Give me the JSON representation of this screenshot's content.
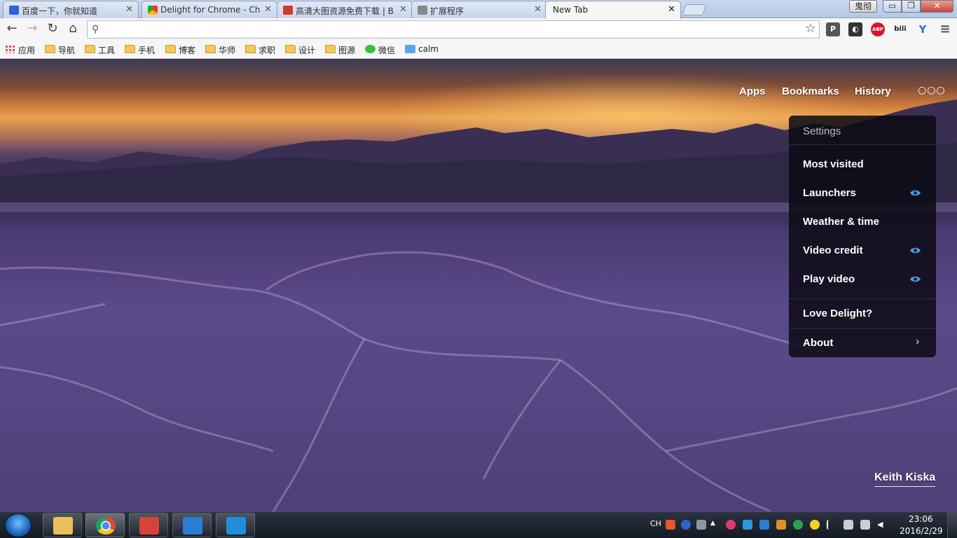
{
  "tabs": [
    {
      "title": "百度一下，你就知道",
      "favicon": "baidu-paw-icon",
      "color": "#3060d8"
    },
    {
      "title": "Delight for Chrome - Ch",
      "favicon": "chrome-webstore-icon",
      "color": "#e8a030"
    },
    {
      "title": "高清大图资源免费下载 | B",
      "favicon": "site-red-icon",
      "color": "#d23a2a"
    },
    {
      "title": "扩展程序",
      "favicon": "puzzle-icon",
      "color": "#777777"
    },
    {
      "title": "New Tab",
      "favicon": "",
      "color": ""
    }
  ],
  "window": {
    "user": "鬼彻",
    "min": "▭",
    "max": "❐",
    "close": "✕"
  },
  "toolbar": {
    "back": "←",
    "forward": "→",
    "reload": "↻",
    "home": "⌂",
    "omnibox_value": "",
    "star": "☆"
  },
  "extensions": [
    {
      "name": "pocket-icon",
      "label": "P",
      "color": "#444444"
    },
    {
      "name": "mask-icon",
      "label": "◐",
      "color": "#333333"
    },
    {
      "name": "adblock-plus-icon",
      "label": "ABP",
      "color": "#d4162c"
    },
    {
      "name": "bilibili-icon",
      "label": "bili",
      "color": "#222222"
    },
    {
      "name": "shield-y-icon",
      "label": "Y",
      "color": "#2177d4"
    },
    {
      "name": "menu-icon",
      "label": "≡",
      "color": "#555555"
    }
  ],
  "bookmarks": [
    "应用",
    "导航",
    "工具",
    "手机",
    "博客",
    "华师",
    "求职",
    "设计",
    "图源",
    "微信",
    "calm"
  ],
  "newtab": {
    "nav": [
      "Apps",
      "Bookmarks",
      "History"
    ],
    "dots": "○○○",
    "menu": {
      "header": "Settings",
      "items": [
        "Most visited",
        "Launchers",
        "Weather & time",
        "Video credit",
        "Play video"
      ],
      "love": "Love Delight?",
      "about": "About",
      "chevron": "›"
    },
    "eye_color": "#4a9be0",
    "credit": "Keith Kiska"
  },
  "taskbar": {
    "apps": [
      {
        "name": "file-explorer-app",
        "color": "#e9c15a"
      },
      {
        "name": "chrome-app",
        "color": "#dd4b39"
      },
      {
        "name": "wunderlist-app",
        "color": "#d9423a"
      },
      {
        "name": "word-app",
        "color": "#2b7cd3"
      },
      {
        "name": "sogou-app",
        "color": "#1e8fd8"
      }
    ],
    "ime": "CH",
    "time": "23:06",
    "date": "2016/2/29"
  }
}
